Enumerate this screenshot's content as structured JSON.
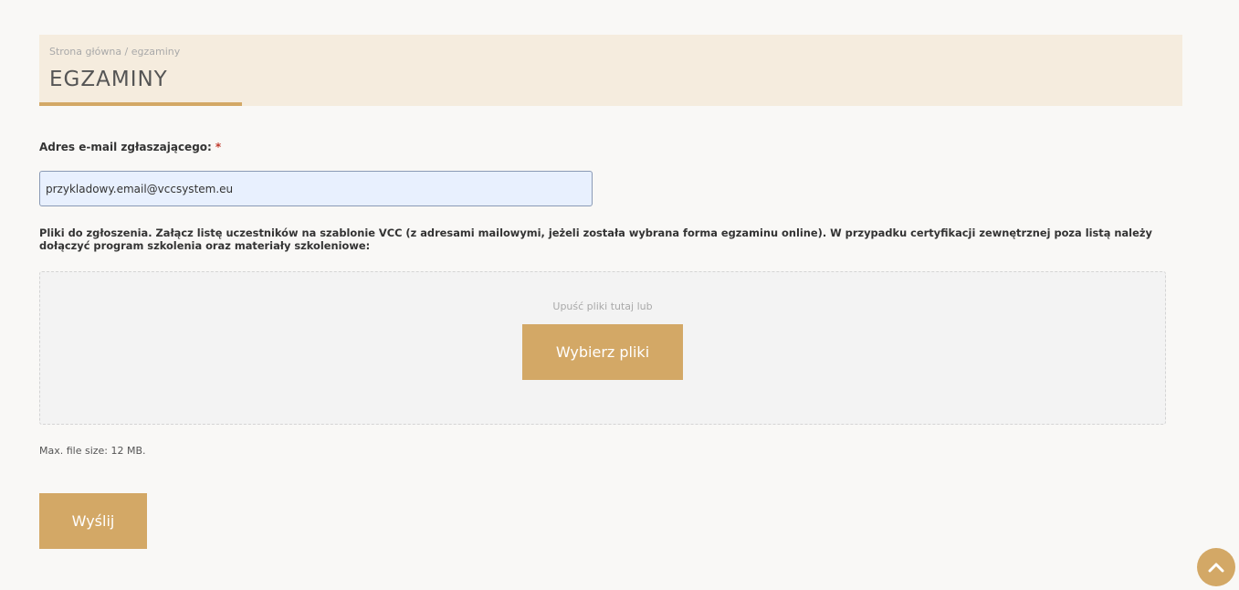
{
  "breadcrumb": "Strona główna / egzaminy",
  "page_title": "EGZAMINY",
  "email_field": {
    "label": "Adres e-mail zgłaszającego:",
    "required_marker": "*",
    "value": "przykladowy.email@vccsystem.eu"
  },
  "files_field": {
    "label": "Pliki do zgłoszenia. Załącz listę uczestników na szablonie VCC (z adresami mailowymi, jeżeli została wybrana forma egzaminu online). W przypadku certyfikacji zewnętrznej poza listą należy dołączyć program szkolenia oraz materiały szkoleniowe:",
    "drop_hint": "Upuść pliki tutaj lub",
    "choose_label": "Wybierz pliki",
    "max_size": "Max. file size: 12 MB."
  },
  "submit_label": "Wyślij",
  "icons": {
    "scroll_top": "chevron-up-icon"
  },
  "colors": {
    "accent": "#d3a866",
    "header_bg": "#f5ecde",
    "required": "#c0392b"
  }
}
